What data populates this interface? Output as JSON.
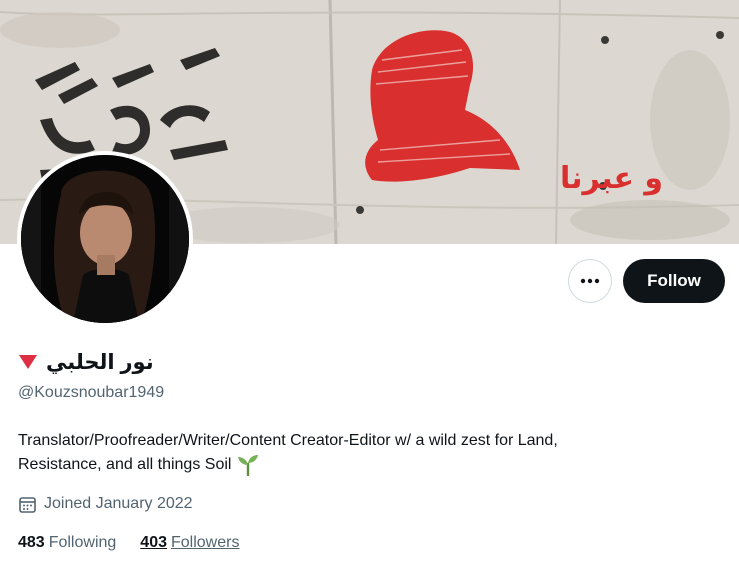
{
  "profile": {
    "display_name": "نور الحلبي",
    "name_emoji": "red-triangle-down",
    "handle": "@Kouzsnoubar1949",
    "bio_line1": "Translator/Proofreader/Writer/Content Creator-Editor w/ a wild zest for Land,",
    "bio_line2": "Resistance, and all things Soil",
    "bio_emoji": "seedling-icon",
    "joined": "Joined January 2022",
    "following_count": "483",
    "following_label": "Following",
    "followers_count": "403",
    "followers_label": "Followers"
  },
  "banner": {
    "graffiti_left": "غزة",
    "graffiti_red": "و عبرنا"
  },
  "actions": {
    "more_label": "•••",
    "follow_label": "Follow"
  },
  "colors": {
    "primary_text": "#0f1419",
    "secondary_text": "#536471",
    "follow_bg": "#0f1419",
    "stencil_red": "#d9302f",
    "seedling_green": "#78b159"
  }
}
